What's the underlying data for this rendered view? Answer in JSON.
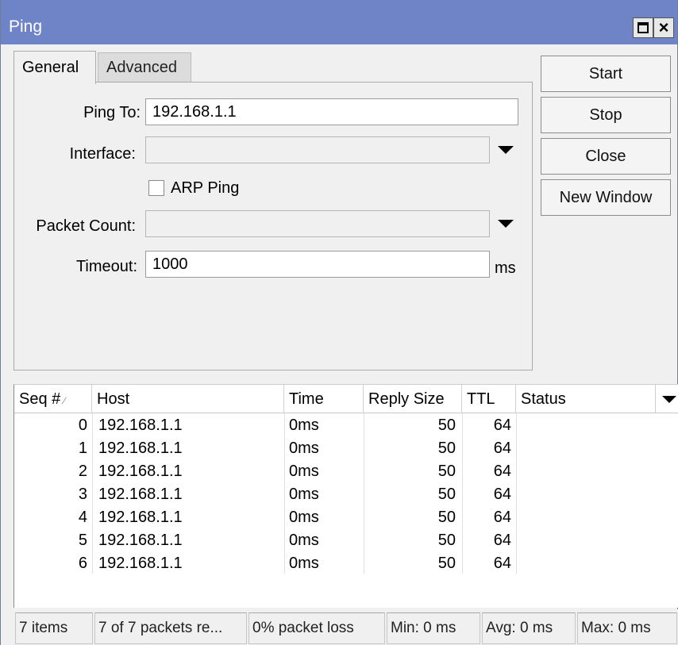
{
  "window": {
    "title": "Ping"
  },
  "tabs": [
    {
      "label": "General",
      "active": true
    },
    {
      "label": "Advanced",
      "active": false
    }
  ],
  "form": {
    "ping_to_label": "Ping To:",
    "ping_to_value": "192.168.1.1",
    "interface_label": "Interface:",
    "interface_value": "",
    "arp_ping_label": "ARP Ping",
    "arp_ping_checked": false,
    "packet_count_label": "Packet Count:",
    "packet_count_value": "",
    "timeout_label": "Timeout:",
    "timeout_value": "1000",
    "timeout_unit": "ms"
  },
  "buttons": {
    "start": "Start",
    "stop": "Stop",
    "close": "Close",
    "new_window": "New Window"
  },
  "table": {
    "columns": [
      "Seq #",
      "Host",
      "Time",
      "Reply Size",
      "TTL",
      "Status"
    ],
    "sort_indicator": "∕",
    "rows": [
      {
        "seq": "0",
        "host": "192.168.1.1",
        "time": "0ms",
        "reply_size": "50",
        "ttl": "64",
        "status": ""
      },
      {
        "seq": "1",
        "host": "192.168.1.1",
        "time": "0ms",
        "reply_size": "50",
        "ttl": "64",
        "status": ""
      },
      {
        "seq": "2",
        "host": "192.168.1.1",
        "time": "0ms",
        "reply_size": "50",
        "ttl": "64",
        "status": ""
      },
      {
        "seq": "3",
        "host": "192.168.1.1",
        "time": "0ms",
        "reply_size": "50",
        "ttl": "64",
        "status": ""
      },
      {
        "seq": "4",
        "host": "192.168.1.1",
        "time": "0ms",
        "reply_size": "50",
        "ttl": "64",
        "status": ""
      },
      {
        "seq": "5",
        "host": "192.168.1.1",
        "time": "0ms",
        "reply_size": "50",
        "ttl": "64",
        "status": ""
      },
      {
        "seq": "6",
        "host": "192.168.1.1",
        "time": "0ms",
        "reply_size": "50",
        "ttl": "64",
        "status": ""
      }
    ]
  },
  "status_bar": {
    "items": "7 items",
    "received": "7 of 7 packets re...",
    "loss": "0% packet loss",
    "min": "Min: 0 ms",
    "avg": "Avg: 0 ms",
    "max": "Max: 0 ms"
  }
}
